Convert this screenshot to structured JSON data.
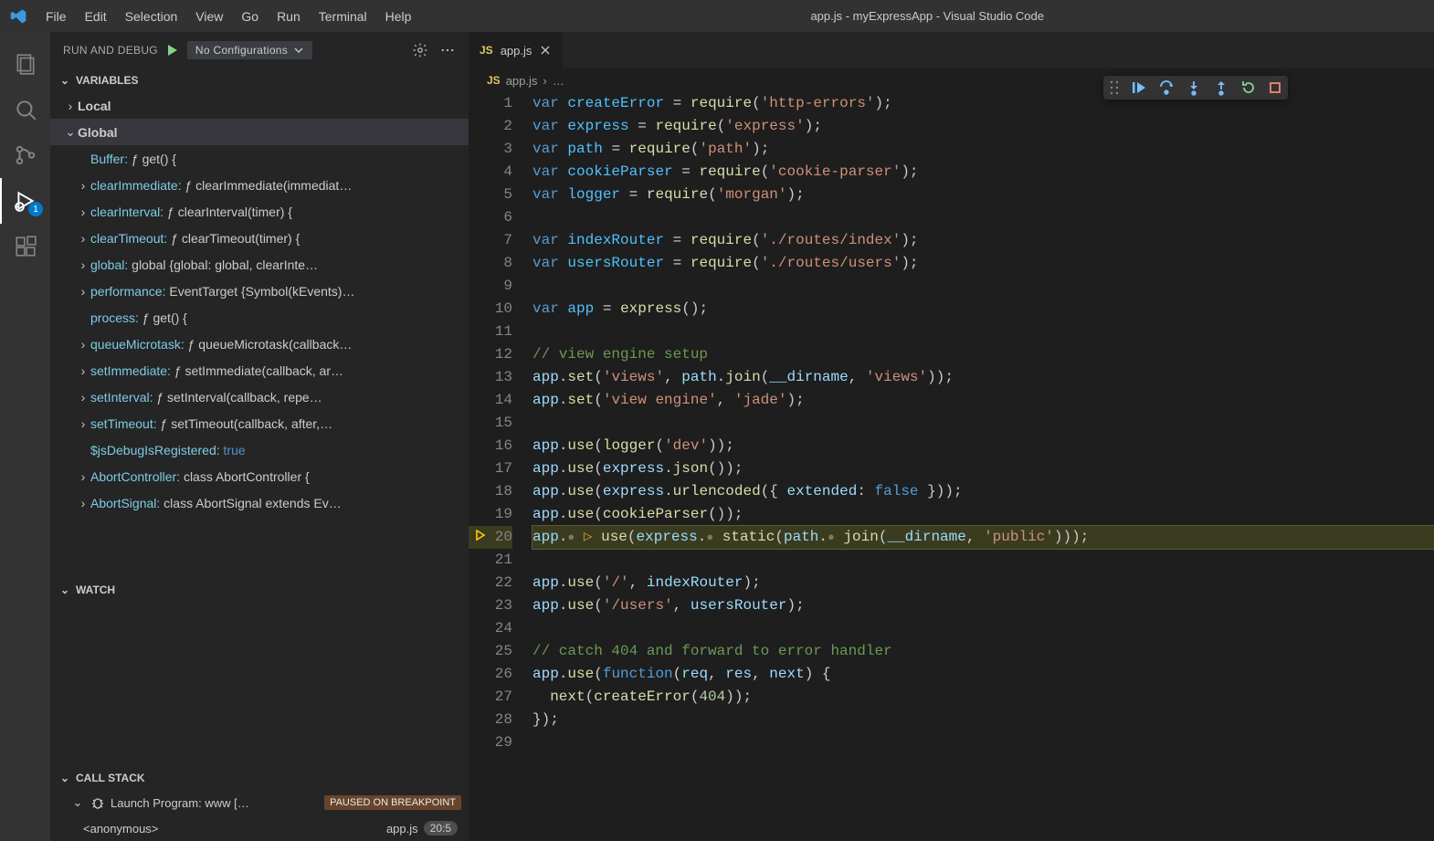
{
  "window_title": "app.js - myExpressApp - Visual Studio Code",
  "menu": [
    "File",
    "Edit",
    "Selection",
    "View",
    "Go",
    "Run",
    "Terminal",
    "Help"
  ],
  "activity_badge": "1",
  "sidebar": {
    "title": "RUN AND DEBUG",
    "config": "No Configurations",
    "sections": {
      "variables": "VARIABLES",
      "local": "Local",
      "global": "Global",
      "watch": "WATCH",
      "callstack": "CALL STACK"
    },
    "globals": [
      {
        "name": "Buffer:",
        "value": "ƒ get() {",
        "chev": false
      },
      {
        "name": "clearImmediate:",
        "value": "ƒ clearImmediate(immediat…",
        "chev": true
      },
      {
        "name": "clearInterval:",
        "value": "ƒ clearInterval(timer) {",
        "chev": true
      },
      {
        "name": "clearTimeout:",
        "value": "ƒ clearTimeout(timer) {",
        "chev": true
      },
      {
        "name": "global:",
        "value": "global {global: global, clearInte…",
        "chev": true
      },
      {
        "name": "performance:",
        "value": "EventTarget {Symbol(kEvents)…",
        "chev": true
      },
      {
        "name": "process:",
        "value": "ƒ get() {",
        "chev": false
      },
      {
        "name": "queueMicrotask:",
        "value": "ƒ queueMicrotask(callback…",
        "chev": true
      },
      {
        "name": "setImmediate:",
        "value": "ƒ setImmediate(callback, ar…",
        "chev": true
      },
      {
        "name": "setInterval:",
        "value": "ƒ setInterval(callback, repe…",
        "chev": true
      },
      {
        "name": "setTimeout:",
        "value": "ƒ setTimeout(callback, after,…",
        "chev": true
      },
      {
        "name": "$jsDebugIsRegistered:",
        "value": "true",
        "bool": true,
        "chev": false
      },
      {
        "name": "AbortController:",
        "value": "class AbortController {",
        "chev": true
      },
      {
        "name": "AbortSignal:",
        "value": "class AbortSignal extends Ev…",
        "chev": true
      }
    ],
    "callstack": {
      "program": "Launch Program: www […",
      "status": "PAUSED ON BREAKPOINT",
      "frame": "<anonymous>",
      "frame_file": "app.js",
      "frame_loc": "20:5"
    }
  },
  "tab": {
    "file": "app.js"
  },
  "breadcrumb": {
    "file": "app.js",
    "sep": "›",
    "more": "…"
  },
  "code": {
    "lines": [
      {
        "n": 1,
        "html": "<span class='tk-kw'>var</span> <span class='tk-var'>createError</span> <span class='tk-op'>=</span> <span class='tk-fn'>require</span>(<span class='tk-str'>'http-errors'</span>);"
      },
      {
        "n": 2,
        "html": "<span class='tk-kw'>var</span> <span class='tk-var'>express</span> <span class='tk-op'>=</span> <span class='tk-fn'>require</span>(<span class='tk-str'>'express'</span>);"
      },
      {
        "n": 3,
        "html": "<span class='tk-kw'>var</span> <span class='tk-var'>path</span> <span class='tk-op'>=</span> <span class='tk-fn'>require</span>(<span class='tk-str'>'path'</span>);"
      },
      {
        "n": 4,
        "html": "<span class='tk-kw'>var</span> <span class='tk-var'>cookieParser</span> <span class='tk-op'>=</span> <span class='tk-fn'>require</span>(<span class='tk-str'>'cookie-parser'</span>);"
      },
      {
        "n": 5,
        "html": "<span class='tk-kw'>var</span> <span class='tk-var'>logger</span> <span class='tk-op'>=</span> <span class='tk-fn'>require</span>(<span class='tk-str'>'morgan'</span>);"
      },
      {
        "n": 6,
        "html": ""
      },
      {
        "n": 7,
        "html": "<span class='tk-kw'>var</span> <span class='tk-var'>indexRouter</span> <span class='tk-op'>=</span> <span class='tk-fn'>require</span>(<span class='tk-str'>'./routes/index'</span>);"
      },
      {
        "n": 8,
        "html": "<span class='tk-kw'>var</span> <span class='tk-var'>usersRouter</span> <span class='tk-op'>=</span> <span class='tk-fn'>require</span>(<span class='tk-str'>'./routes/users'</span>);"
      },
      {
        "n": 9,
        "html": ""
      },
      {
        "n": 10,
        "html": "<span class='tk-kw'>var</span> <span class='tk-var'>app</span> <span class='tk-op'>=</span> <span class='tk-fn'>express</span>();"
      },
      {
        "n": 11,
        "html": ""
      },
      {
        "n": 12,
        "html": "<span class='tk-com'>// view engine setup</span>"
      },
      {
        "n": 13,
        "html": "<span class='tk-prop'>app</span>.<span class='tk-fn'>set</span>(<span class='tk-str'>'views'</span>, <span class='tk-prop'>path</span>.<span class='tk-fn'>join</span>(<span class='tk-prop'>__dirname</span>, <span class='tk-str'>'views'</span>));"
      },
      {
        "n": 14,
        "html": "<span class='tk-prop'>app</span>.<span class='tk-fn'>set</span>(<span class='tk-str'>'view engine'</span>, <span class='tk-str'>'jade'</span>);"
      },
      {
        "n": 15,
        "html": ""
      },
      {
        "n": 16,
        "html": "<span class='tk-prop'>app</span>.<span class='tk-fn'>use</span>(<span class='tk-fn'>logger</span>(<span class='tk-str'>'dev'</span>));"
      },
      {
        "n": 17,
        "html": "<span class='tk-prop'>app</span>.<span class='tk-fn'>use</span>(<span class='tk-prop'>express</span>.<span class='tk-fn'>json</span>());"
      },
      {
        "n": 18,
        "html": "<span class='tk-prop'>app</span>.<span class='tk-fn'>use</span>(<span class='tk-prop'>express</span>.<span class='tk-fn'>urlencoded</span>({ <span class='tk-prop'>extended</span>: <span class='tk-kw'>false</span> }));"
      },
      {
        "n": 19,
        "html": "<span class='tk-prop'>app</span>.<span class='tk-fn'>use</span>(<span class='tk-fn'>cookieParser</span>());"
      },
      {
        "n": 20,
        "hl": true,
        "html": "<span class='tk-prop'>app</span>.<span class='inline-hint'>●</span> <span style='color:#c9a328'>▷</span> <span class='tk-fn'>use</span>(<span class='tk-prop'>express</span>.<span class='inline-hint'>●</span> <span class='tk-fn'>static</span>(<span class='tk-prop'>path</span>.<span class='inline-hint'>●</span> <span class='tk-fn'>join</span>(<span class='tk-prop'>__dirname</span>, <span class='tk-str'>'public'</span>)));"
      },
      {
        "n": 21,
        "html": ""
      },
      {
        "n": 22,
        "html": "<span class='tk-prop'>app</span>.<span class='tk-fn'>use</span>(<span class='tk-str'>'/'</span>, <span class='tk-prop'>indexRouter</span>);"
      },
      {
        "n": 23,
        "html": "<span class='tk-prop'>app</span>.<span class='tk-fn'>use</span>(<span class='tk-str'>'/users'</span>, <span class='tk-prop'>usersRouter</span>);"
      },
      {
        "n": 24,
        "html": ""
      },
      {
        "n": 25,
        "html": "<span class='tk-com'>// catch 404 and forward to error handler</span>"
      },
      {
        "n": 26,
        "html": "<span class='tk-prop'>app</span>.<span class='tk-fn'>use</span>(<span class='tk-kw'>function</span>(<span class='tk-prop'>req</span>, <span class='tk-prop'>res</span>, <span class='tk-prop'>next</span>) {"
      },
      {
        "n": 27,
        "html": "  <span class='tk-fn'>next</span>(<span class='tk-fn'>createError</span>(<span class='tk-num'>404</span>));"
      },
      {
        "n": 28,
        "html": "});"
      },
      {
        "n": 29,
        "html": ""
      }
    ]
  }
}
